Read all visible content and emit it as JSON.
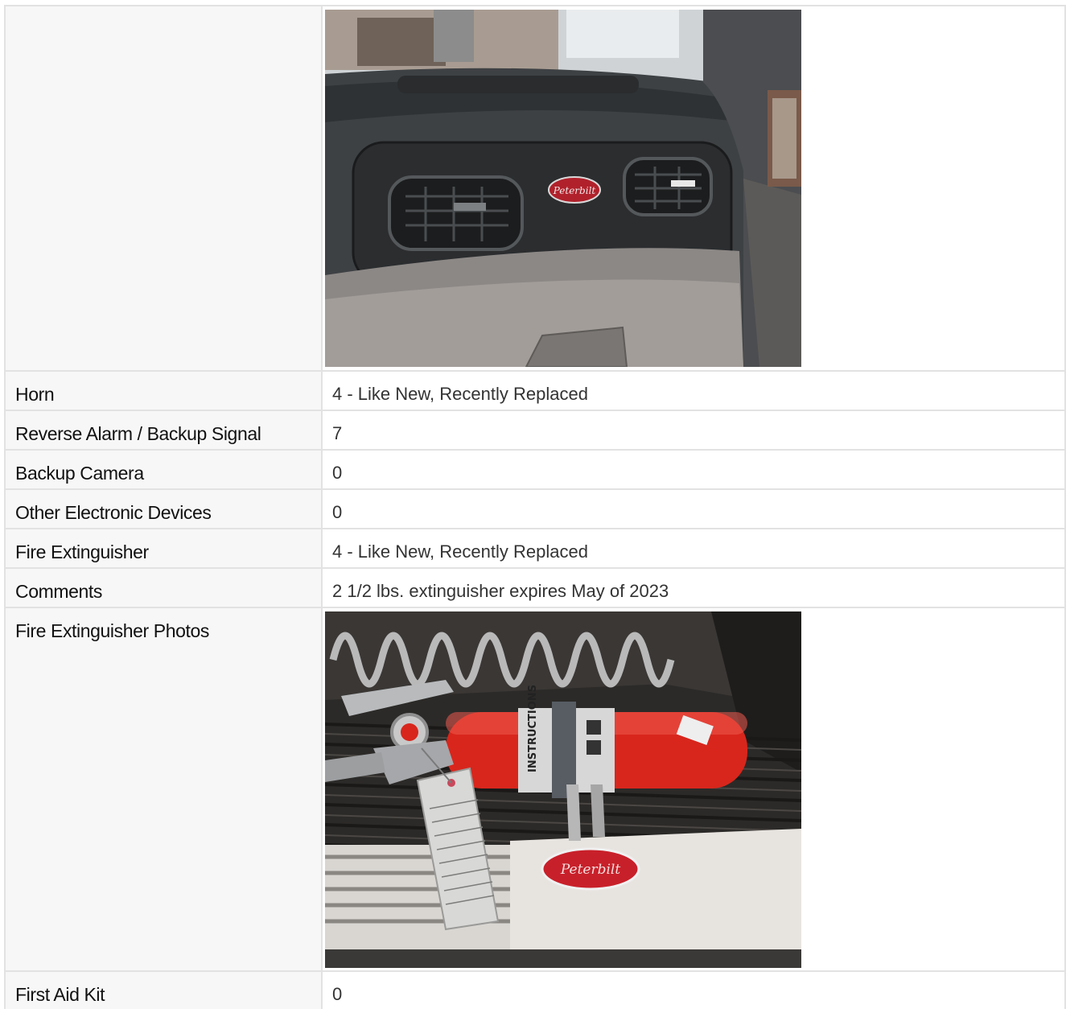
{
  "rows": [
    {
      "label": "",
      "photo": "dashboard-vents-photo"
    },
    {
      "label": "Horn",
      "value": "4 - Like New, Recently Replaced"
    },
    {
      "label": "Reverse Alarm / Backup Signal",
      "value": "7"
    },
    {
      "label": "Backup Camera",
      "value": "0"
    },
    {
      "label": "Other Electronic Devices",
      "value": "0"
    },
    {
      "label": "Fire Extinguisher",
      "value": "4 - Like New, Recently Replaced"
    },
    {
      "label": "Comments",
      "value": "2 1/2 lbs. extinguisher expires May of 2023"
    },
    {
      "label": "Fire Extinguisher Photos",
      "photo": "fire-extinguisher-photo"
    },
    {
      "label": "First Aid Kit",
      "value": "0"
    }
  ],
  "photos": {
    "dashboard": {
      "badge_text": "Peterbilt",
      "badge_color": "#b0212b"
    },
    "extinguisher": {
      "badge_text": "Peterbilt",
      "tank_color": "#d8261c",
      "band_text": "INSTRUCTIONS"
    }
  }
}
